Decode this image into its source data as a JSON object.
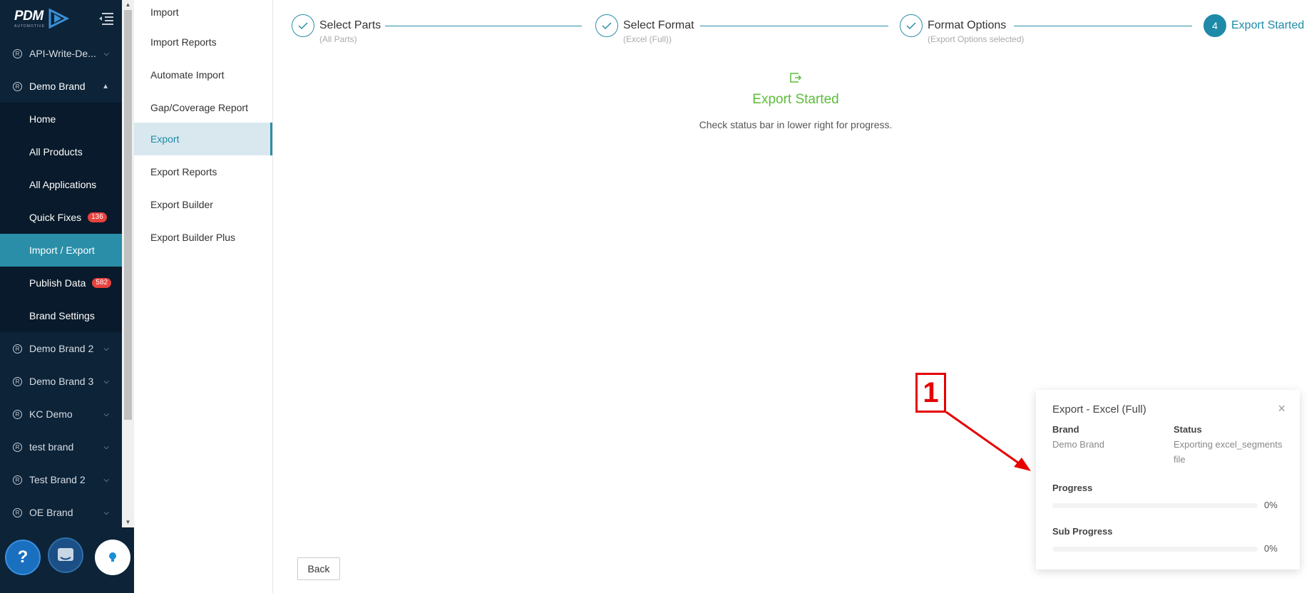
{
  "sidebar": {
    "logo_text": "PDM",
    "logo_sub": "AUTOMOTIVE",
    "brands_top": [
      {
        "label": "API-Write-De...",
        "open": false
      },
      {
        "label": "Demo Brand",
        "open": true
      }
    ],
    "demo_brand_items": [
      {
        "label": "Home"
      },
      {
        "label": "All Products"
      },
      {
        "label": "All Applications"
      },
      {
        "label": "Quick Fixes",
        "badge": "136"
      },
      {
        "label": "Import / Export",
        "active": true
      },
      {
        "label": "Publish Data",
        "badge": "582"
      },
      {
        "label": "Brand Settings"
      }
    ],
    "brands_bottom": [
      {
        "label": "Demo Brand 2"
      },
      {
        "label": "Demo Brand 3"
      },
      {
        "label": "KC Demo"
      },
      {
        "label": "test brand"
      },
      {
        "label": "Test Brand 2"
      },
      {
        "label": "OE Brand"
      }
    ],
    "help_label": "?"
  },
  "submenu": {
    "items": [
      {
        "label": "Import"
      },
      {
        "label": "Import Reports"
      },
      {
        "label": "Automate Import"
      },
      {
        "label": "Gap/Coverage Report"
      },
      {
        "label": "Export",
        "active": true
      },
      {
        "label": "Export Reports"
      },
      {
        "label": "Export Builder"
      },
      {
        "label": "Export Builder Plus"
      }
    ]
  },
  "steps": [
    {
      "title": "Select Parts",
      "sub": "(All Parts)",
      "done": true
    },
    {
      "title": "Select Format",
      "sub": "(Excel (Full))",
      "done": true
    },
    {
      "title": "Format Options",
      "sub": "(Export Options selected)",
      "done": true
    },
    {
      "title": "Export Started",
      "sub": "",
      "number": "4",
      "current": true
    }
  ],
  "result": {
    "title": "Export Started",
    "description": "Check status bar in lower right for progress."
  },
  "back_label": "Back",
  "notification": {
    "title": "Export - Excel (Full)",
    "close": "×",
    "brand_label": "Brand",
    "brand_value": "Demo Brand",
    "status_label": "Status",
    "status_value": "Exporting excel_segments file",
    "progress_label": "Progress",
    "progress_value": "0%",
    "progress_fraction": 0,
    "sub_progress_label": "Sub Progress",
    "sub_progress_value": "0%",
    "sub_progress_fraction": 0
  },
  "annotation": {
    "label": "1"
  },
  "colors": {
    "sidebar_bg": "#0c2338",
    "accent": "#2a8ea8",
    "success": "#5cbd3a",
    "badge": "#e8423e",
    "annotation": "#e60000"
  }
}
